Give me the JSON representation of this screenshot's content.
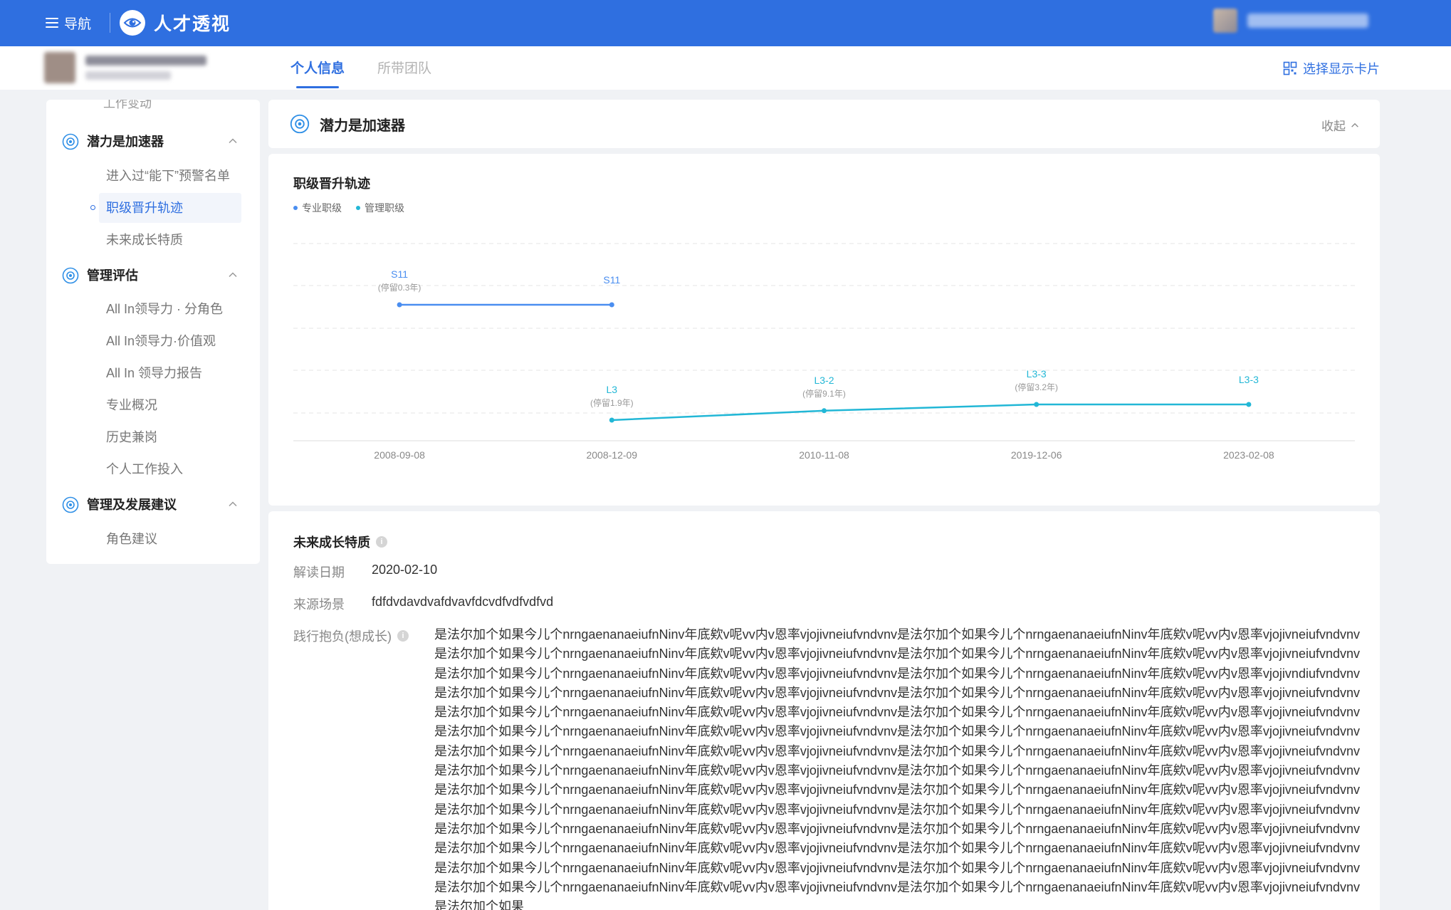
{
  "topbar": {
    "nav_label": "导航",
    "brand": "人才透视"
  },
  "tabs": [
    {
      "label": "个人信息",
      "active": true
    },
    {
      "label": "所带团队",
      "active": false
    }
  ],
  "select_cards_label": "选择显示卡片",
  "sidebar": {
    "top_cut_label": "工作变动",
    "groups": [
      {
        "label": "潜力是加速器",
        "items": [
          "进入过“能下”预警名单",
          "职级晋升轨迹",
          "未来成长特质"
        ],
        "active_item": 1
      },
      {
        "label": "管理评估",
        "items": [
          "All In领导力 · 分角色",
          "All In领导力·价值观",
          "All In 领导力报告",
          "专业概况",
          "历史兼岗",
          "个人工作投入"
        ]
      },
      {
        "label": "管理及发展建议",
        "items": [
          "角色建议"
        ]
      }
    ]
  },
  "section": {
    "title": "潜力是加速器",
    "collapse_label": "收起"
  },
  "chart_title": "职级晋升轨迹",
  "legend": [
    {
      "name": "专业职级",
      "color": "#4a8ef0"
    },
    {
      "name": "管理职级",
      "color": "#22b7d6"
    }
  ],
  "chart_data": {
    "type": "line",
    "title": "职级晋升轨迹",
    "x": [
      "2008-09-08",
      "2008-12-09",
      "2010-11-08",
      "2019-12-06",
      "2023-02-08"
    ],
    "series": [
      {
        "name": "专业职级",
        "color": "#4a8ef0",
        "points": [
          {
            "x": "2008-09-08",
            "label": "S11",
            "note": "(停留0.3年)",
            "level": 4
          },
          {
            "x": "2008-12-09",
            "label": "S11",
            "note": "",
            "level": 4
          }
        ]
      },
      {
        "name": "管理职级",
        "color": "#22b7d6",
        "points": [
          {
            "x": "2008-12-09",
            "label": "L3",
            "note": "(停留1.9年)",
            "level": 1
          },
          {
            "x": "2010-11-08",
            "label": "L3-2",
            "note": "(停留9.1年)",
            "level": 1.3
          },
          {
            "x": "2019-12-06",
            "label": "L3-3",
            "note": "(停留3.2年)",
            "level": 1.5
          },
          {
            "x": "2023-02-08",
            "label": "L3-3",
            "note": "",
            "level": 1.5
          }
        ]
      }
    ],
    "grid": true,
    "legend_position": "top-left"
  },
  "growth": {
    "title": "未来成长特质",
    "date_label": "解读日期",
    "date_value": "2020-02-10",
    "source_label": "来源场景",
    "source_value": "fdfdvdavdvafdvavfdcvdfvdfvdfvd",
    "ambition_label": "践行抱负(想成长)",
    "ambition_text": "是法尔加个如果今儿个nrngaenanaeiufnNinv年底欸v呢vv内v恩率vjojivneiufvndvnv是法尔加个如果今儿个nrngaenanaeiufnNinv年底欸v呢vv内v恩率vjojivneiufvndvnv是法尔加个如果今儿个nrngaenanaeiufnNinv年底欸v呢vv内v恩率vjojivneiufvndvnv是法尔加个如果今儿个nrngaenanaeiufnNinv年底欸v呢vv内v恩率vjojivneiufvndvnv是法尔加个如果今儿个nrngaenanaeiufnNinv年底欸v呢vv内v恩率vjojivneiufvndvnv是法尔加个如果今儿个nrngaenanaeiufnNinv年底欸v呢vv内v恩率vjojivndiufvndvnv是法尔加个如果今儿个nrngaenanaeiufnNinv年底欸v呢vv内v恩率vjojivneiufvndvnv是法尔加个如果今儿个nrngaenanaeiufnNinv年底欸v呢vv内v恩率vjojivneiufvndvnv是法尔加个如果今儿个nrngaenanaeiufnNinv年底欸v呢vv内v恩率vjojivneiufvndvnv是法尔加个如果今儿个nrngaenanaeiufnNinv年底欸v呢vv内v恩率vjojivneiufvndvnv是法尔加个如果今儿个nrngaenanaeiufnNinv年底欸v呢vv内v恩率vjojivneiufvndvnv是法尔加个如果今儿个nrngaenanaeiufnNinv年底欸v呢vv内v恩率vjojivneiufvndvnv是法尔加个如果今儿个nrngaenanaeiufnNinv年底欸v呢vv内v恩率vjojivneiufvndvnv是法尔加个如果今儿个nrngaenanaeiufnNinv年底欸v呢vv内v恩率vjojivneiufvndvnv是法尔加个如果今儿个nrngaenanaeiufnNinv年底欸v呢vv内v恩率vjojivneiufvndvnv是法尔加个如果今儿个nrngaenanaeiufnNinv年底欸v呢vv内v恩率vjojivneiufvndvnv是法尔加个如果今儿个nrngaenanaeiufnNinv年底欸v呢vv内v恩率vjojivneiufvndvnv是法尔加个如果今儿个nrngaenanaeiufnNinv年底欸v呢vv内v恩率vjojivneiufvndvnv是法尔加个如果今儿个nrngaenanaeiufnNinv年底欸v呢vv内v恩率vjojivneiufvndvnv是法尔加个如果今儿个nrngaenanaeiufnNinv年底欸v呢vv内v恩率vjojivneiufvndvnv是法尔加个如果今儿个nrngaenanaeiufnNinv年底欸v呢vv内v恩率vjojivneiufvndvnv是法尔加个如果今儿个nrngaenanaeiufnNinv年底欸v呢vv内v恩率vjojivneiufvndvnv是法尔加个如果今儿个nrngaenanaeiufnNinv年底欸v呢vv内v恩率vjojivneiufvndvnv是法尔加个如果今儿个nrngaenanaeiufnNinv年底欸v呢vv内v恩率vjojivneiufvndvnv是法尔加个如果今儿个nrngaenanaeiufnNinv年底欸v呢vv内v恩率vjojivneiufvndvnv是法尔加个如果今儿个nrngaenanaeiufnNinv年底欸v呢vv内v恩率vjojivneiufvndvnv是法尔加个如果今儿个nrngaenanaeiufnNinv年底欸v呢vv内v恩率vjojivneiufvndvnv是法尔加个如果今儿个nrngaenanaeiufnNinv年底欸v呢vv内v恩率vjojivneiufvndvnv是法尔加个如果"
  }
}
